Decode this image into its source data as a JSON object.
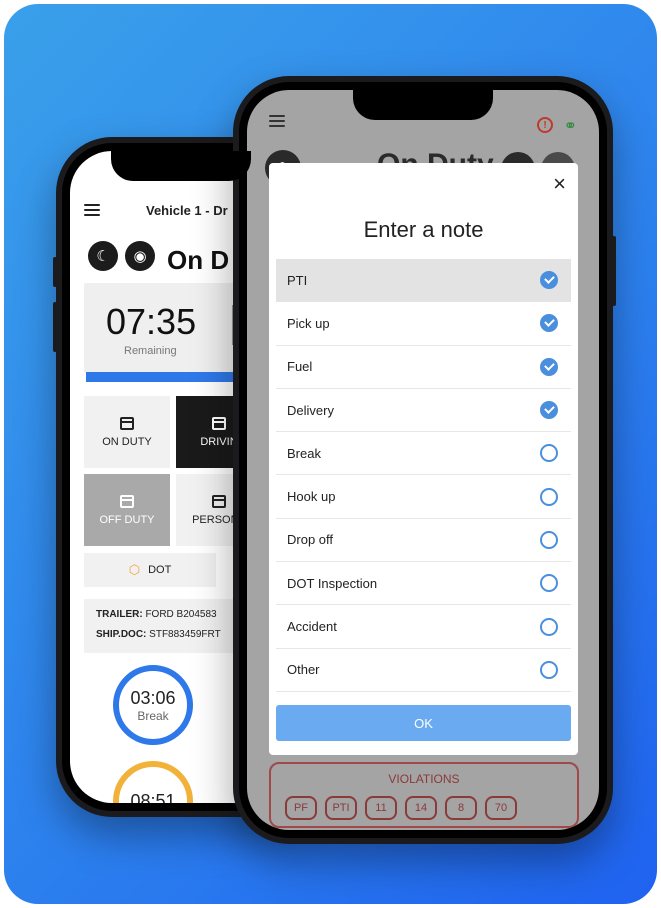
{
  "back_phone": {
    "header_title": "Vehicle 1 - Dr",
    "status": "On D",
    "timer": {
      "value": "07:35",
      "label": "Remaining"
    },
    "tiles": [
      {
        "label": "ON DUTY",
        "style": "light"
      },
      {
        "label": "DRIVIN",
        "style": "dark"
      },
      {
        "label": "OFF DUTY",
        "style": "grey"
      },
      {
        "label": "PERSONA",
        "style": "light"
      }
    ],
    "dot_button": "DOT",
    "info": {
      "trailer_label": "TRAILER:",
      "trailer_value": "FORD B204583",
      "shipdoc_label": "SHIP.DOC:",
      "shipdoc_value": "STF883459FRT"
    },
    "rings": [
      {
        "time": "03:06",
        "label": "Break",
        "color": "#2f78ea"
      },
      {
        "time": "08:51",
        "label": "",
        "color": "#f2b23a"
      }
    ]
  },
  "front_phone": {
    "title": "On Duty",
    "violations": {
      "title": "VIOLATIONS",
      "chips": [
        "PF",
        "PTI",
        "11",
        "14",
        "8",
        "70"
      ]
    }
  },
  "modal": {
    "title": "Enter a note",
    "close_label": "×",
    "ok_label": "OK",
    "items": [
      {
        "label": "PTI",
        "checked": true,
        "highlighted": true
      },
      {
        "label": "Pick up",
        "checked": true
      },
      {
        "label": "Fuel",
        "checked": true
      },
      {
        "label": "Delivery",
        "checked": true
      },
      {
        "label": "Break",
        "checked": false
      },
      {
        "label": "Hook up",
        "checked": false
      },
      {
        "label": "Drop off",
        "checked": false
      },
      {
        "label": "DOT Inspection",
        "checked": false
      },
      {
        "label": "Accident",
        "checked": false
      },
      {
        "label": "Other",
        "checked": false
      }
    ]
  },
  "colors": {
    "accent": "#4a8fde",
    "ok_button": "#6aaaf0",
    "violation": "#8a3a3a",
    "background_gradient_start": "#3aa0ea",
    "background_gradient_end": "#1f62f0"
  }
}
